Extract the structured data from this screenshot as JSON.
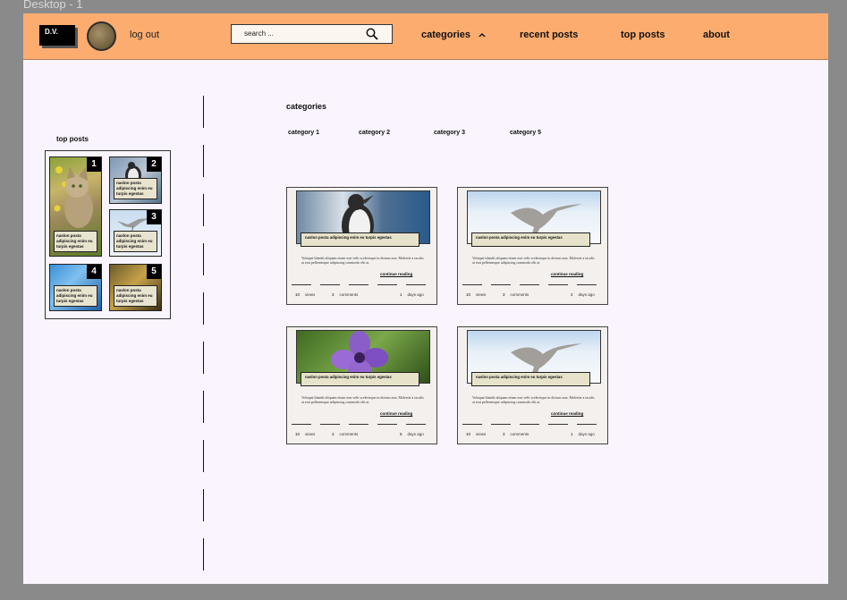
{
  "frame": {
    "title": "Desktop - 1"
  },
  "header": {
    "logo": "D.V.",
    "logout": "log out",
    "search_placeholder": "search ...",
    "nav": [
      "categories",
      "recent posts",
      "top posts",
      "about"
    ]
  },
  "sidebar": {
    "heading": "top posts",
    "posts": [
      {
        "rank": "1",
        "caption": "naslon posta adipiscing enim eu turpis egestas"
      },
      {
        "rank": "2",
        "caption": "naslon posta adipiscing enim eu turpis egestas"
      },
      {
        "rank": "3",
        "caption": "naslon posta adipiscing enim eu turpis egestas"
      },
      {
        "rank": "4",
        "caption": "naslon posta adipiscing enim eu turpis egestas"
      },
      {
        "rank": "5",
        "caption": "naslon posta adipiscing enim eu turpis egestas"
      }
    ]
  },
  "main": {
    "heading": "categories",
    "categories": [
      "category 1",
      "category 2",
      "category 3",
      "category 5"
    ],
    "cards": [
      {
        "title": "naslon posta adipiscing enim eu turpis egestas",
        "body": "Volutpat blandit aliquam etiam erat velit scelerisque in dictum non. Molestie a iaculis at erat pellentesque adipiscing commodo elit at.",
        "more": "continue reading",
        "views": "10",
        "views_label": "views",
        "comments": "3",
        "comments_label": "comments",
        "days": "1",
        "days_label": "days ago"
      },
      {
        "title": "naslon posta adipiscing enim eu turpis egestas",
        "body": "Volutpat blandit aliquam etiam erat velit scelerisque in dictum non. Molestie a iaculis at erat pellentesque adipiscing commodo elit at.",
        "more": "continue reading",
        "views": "10",
        "views_label": "views",
        "comments": "3",
        "comments_label": "comments",
        "days": "2",
        "days_label": "days ago"
      },
      {
        "title": "naslon posta adipiscing enim eu turpis egestas",
        "body": "Volutpat blandit aliquam etiam erat velit scelerisque in dictum non. Molestie a iaculis at erat pellentesque adipiscing commodo elit at.",
        "more": "continue reading",
        "views": "10",
        "views_label": "views",
        "comments": "3",
        "comments_label": "comments",
        "days": "5",
        "days_label": "days ago"
      },
      {
        "title": "naslon posta adipiscing enim eu turpis egestas",
        "body": "Volutpat blandit aliquam etiam erat velit scelerisque in dictum non. Molestie a iaculis at erat pellentesque adipiscing commodo elit at.",
        "more": "continue reading",
        "views": "10",
        "views_label": "views",
        "comments": "3",
        "comments_label": "comments",
        "days": "1",
        "days_label": "days ago"
      }
    ]
  },
  "colors": {
    "header": "#fdac70",
    "page": "#f9f4fd",
    "canvas": "#8a8a8a",
    "caption_bg": "#e7e3cb"
  }
}
